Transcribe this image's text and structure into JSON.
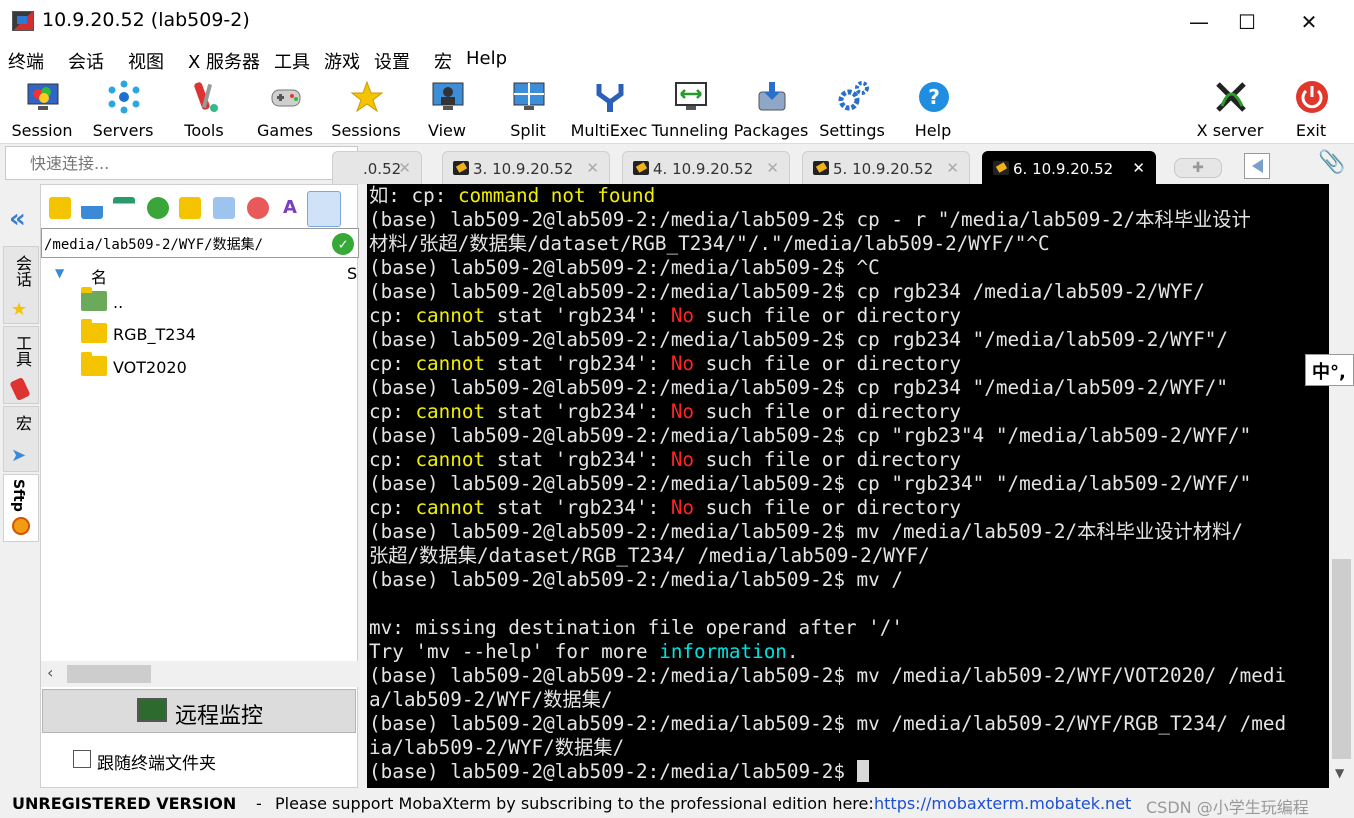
{
  "window": {
    "title": "10.9.20.52 (lab509-2)",
    "minimize_glyph": "—",
    "maximize_glyph": "☐",
    "close_glyph": "✕"
  },
  "menu": [
    "终端",
    "会话",
    "视图",
    "X 服务器",
    "工具",
    "游戏",
    "设置",
    "宏",
    "Help"
  ],
  "toolbar": [
    {
      "label": "Session",
      "icon": "session-icon"
    },
    {
      "label": "Servers",
      "icon": "servers-icon"
    },
    {
      "label": "Tools",
      "icon": "tools-icon"
    },
    {
      "label": "Games",
      "icon": "games-icon"
    },
    {
      "label": "Sessions",
      "icon": "star-icon"
    },
    {
      "label": "View",
      "icon": "view-icon"
    },
    {
      "label": "Split",
      "icon": "split-icon"
    },
    {
      "label": "MultiExec",
      "icon": "multiexec-icon"
    },
    {
      "label": "Tunneling",
      "icon": "tunneling-icon"
    },
    {
      "label": "Packages",
      "icon": "packages-icon"
    },
    {
      "label": "Settings",
      "icon": "settings-icon"
    },
    {
      "label": "Help",
      "icon": "help-icon"
    },
    {
      "label": "X server",
      "icon": "xserver-icon"
    },
    {
      "label": "Exit",
      "icon": "power-icon"
    }
  ],
  "quick_connect": {
    "placeholder": "快速连接..."
  },
  "tabs": [
    {
      "label": ".0.52",
      "close": "✕"
    },
    {
      "label": "3. 10.9.20.52",
      "close": "✕"
    },
    {
      "label": "4. 10.9.20.52",
      "close": "✕"
    },
    {
      "label": "5. 10.9.20.52",
      "close": "✕"
    },
    {
      "label": "6. 10.9.20.52",
      "close": "✕",
      "active": true
    }
  ],
  "side_tabs": [
    "会话",
    "工具",
    "宏",
    "Sftp"
  ],
  "sftp": {
    "path": "/media/lab509-2/WYF/数据集/",
    "column_name": "名",
    "column_size": "S",
    "files": [
      {
        "name": "..",
        "type": "parent"
      },
      {
        "name": "RGB_T234",
        "type": "folder"
      },
      {
        "name": "VOT2020",
        "type": "folder"
      }
    ],
    "monitor_button": "远程监控",
    "follow_label": "跟随终端文件夹",
    "follow_checked": false
  },
  "terminal": {
    "lines": [
      [
        {
          "t": "如: cp: "
        },
        {
          "t": "command not found",
          "c": "yellow"
        }
      ],
      [
        {
          "t": "(base) lab509-2@lab509-2:/media/lab509-2$ cp - r \"/media/lab509-2/本科毕业设计"
        }
      ],
      [
        {
          "t": "材料/张超/数据集/dataset/RGB_T234/\"/.\"/media/lab509-2/WYF/\"^C"
        }
      ],
      [
        {
          "t": "(base) lab509-2@lab509-2:/media/lab509-2$ ^C"
        }
      ],
      [
        {
          "t": "(base) lab509-2@lab509-2:/media/lab509-2$ cp rgb234 /media/lab509-2/WYF/"
        }
      ],
      [
        {
          "t": "cp: "
        },
        {
          "t": "cannot",
          "c": "yellow"
        },
        {
          "t": " stat 'rgb234': "
        },
        {
          "t": "No",
          "c": "red"
        },
        {
          "t": " such file or directory"
        }
      ],
      [
        {
          "t": "(base) lab509-2@lab509-2:/media/lab509-2$ cp rgb234 \"/media/lab509-2/WYF\"/"
        }
      ],
      [
        {
          "t": "cp: "
        },
        {
          "t": "cannot",
          "c": "yellow"
        },
        {
          "t": " stat 'rgb234': "
        },
        {
          "t": "No",
          "c": "red"
        },
        {
          "t": " such file or directory"
        }
      ],
      [
        {
          "t": "(base) lab509-2@lab509-2:/media/lab509-2$ cp rgb234 \"/media/lab509-2/WYF/\""
        }
      ],
      [
        {
          "t": "cp: "
        },
        {
          "t": "cannot",
          "c": "yellow"
        },
        {
          "t": " stat 'rgb234': "
        },
        {
          "t": "No",
          "c": "red"
        },
        {
          "t": " such file or directory"
        }
      ],
      [
        {
          "t": "(base) lab509-2@lab509-2:/media/lab509-2$ cp \"rgb23\"4 \"/media/lab509-2/WYF/\""
        }
      ],
      [
        {
          "t": "cp: "
        },
        {
          "t": "cannot",
          "c": "yellow"
        },
        {
          "t": " stat 'rgb234': "
        },
        {
          "t": "No",
          "c": "red"
        },
        {
          "t": " such file or directory"
        }
      ],
      [
        {
          "t": "(base) lab509-2@lab509-2:/media/lab509-2$ cp \"rgb234\" \"/media/lab509-2/WYF/\""
        }
      ],
      [
        {
          "t": "cp: "
        },
        {
          "t": "cannot",
          "c": "yellow"
        },
        {
          "t": " stat 'rgb234': "
        },
        {
          "t": "No",
          "c": "red"
        },
        {
          "t": " such file or directory"
        }
      ],
      [
        {
          "t": "(base) lab509-2@lab509-2:/media/lab509-2$ mv /media/lab509-2/本科毕业设计材料/"
        }
      ],
      [
        {
          "t": "张超/数据集/dataset/RGB_T234/ /media/lab509-2/WYF/"
        }
      ],
      [
        {
          "t": "(base) lab509-2@lab509-2:/media/lab509-2$ mv /"
        }
      ],
      [
        {
          "t": ""
        }
      ],
      [
        {
          "t": "mv: missing destination file operand after '/'"
        }
      ],
      [
        {
          "t": "Try 'mv --help' for more "
        },
        {
          "t": "information",
          "c": "cyan"
        },
        {
          "t": "."
        }
      ],
      [
        {
          "t": "(base) lab509-2@lab509-2:/media/lab509-2$ mv /media/lab509-2/WYF/VOT2020/ /medi"
        }
      ],
      [
        {
          "t": "a/lab509-2/WYF/数据集/"
        }
      ],
      [
        {
          "t": "(base) lab509-2@lab509-2:/media/lab509-2$ mv /media/lab509-2/WYF/RGB_T234/ /med"
        }
      ],
      [
        {
          "t": "ia/lab509-2/WYF/数据集/"
        }
      ],
      [
        {
          "t": "(base) lab509-2@lab509-2:/media/lab509-2$ "
        },
        {
          "t": "",
          "cursor": true
        }
      ]
    ]
  },
  "ime_indicator": "中°,",
  "status": {
    "unregistered": "UNREGISTERED VERSION",
    "separator": "-",
    "message": "Please support MobaXterm by subscribing to the professional edition here:",
    "link": "https://mobaxterm.mobatek.net",
    "watermark": "CSDN @小学生玩编程"
  },
  "colors": {
    "terminal_bg": "#000000",
    "terminal_fg": "#e4e4e4",
    "warn": "#f0f000",
    "error": "#ff2424",
    "info": "#00e0e0",
    "link": "#1a4fd6"
  }
}
